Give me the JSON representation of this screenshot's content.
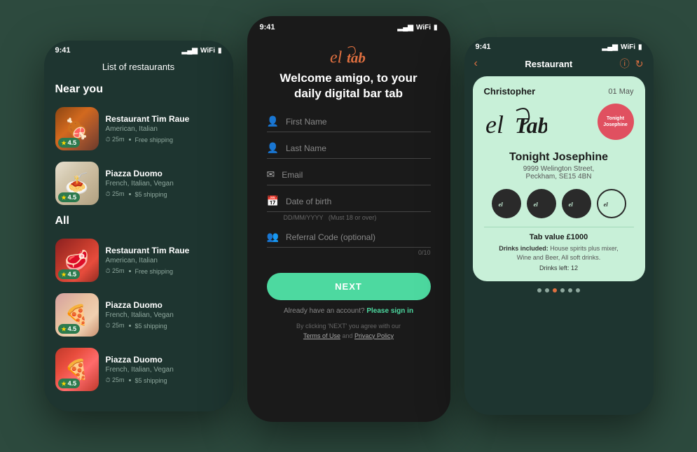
{
  "phone1": {
    "status_time": "9:41",
    "title": "List of restaurants",
    "section_near": "Near you",
    "section_all": "All",
    "restaurants_near": [
      {
        "name": "Restaurant Tim Raue",
        "cuisine": "American, Italian",
        "distance": "25m",
        "shipping": "Free shipping",
        "rating": "4.5",
        "thumb_class": "thumb-food1"
      },
      {
        "name": "Piazza Duomo",
        "cuisine": "French, Italian, Vegan",
        "distance": "25m",
        "shipping": "$5 shipping",
        "rating": "4.5",
        "thumb_class": "thumb-food2"
      }
    ],
    "restaurants_all": [
      {
        "name": "Restaurant Tim Raue",
        "cuisine": "American, Italian",
        "distance": "25m",
        "shipping": "Free shipping",
        "rating": "4.5",
        "thumb_class": "thumb-food3"
      },
      {
        "name": "Piazza Duomo",
        "cuisine": "French, Italian, Vegan",
        "distance": "25m",
        "shipping": "$5 shipping",
        "rating": "4.5",
        "thumb_class": "thumb-food4"
      },
      {
        "name": "Piazza Duomo",
        "cuisine": "French, Italian, Vegan",
        "distance": "25m",
        "shipping": "$5 shipping",
        "rating": "4.5",
        "thumb_class": "thumb-food5"
      }
    ]
  },
  "phone2": {
    "status_time": "9:41",
    "logo_text": "el tab",
    "welcome": "Welcome amigo, to your daily digital bar tab",
    "fields": [
      {
        "placeholder": "First Name",
        "icon": "👤",
        "type": "text"
      },
      {
        "placeholder": "Last Name",
        "icon": "👤",
        "type": "text"
      },
      {
        "placeholder": "Email",
        "icon": "✉",
        "type": "email"
      },
      {
        "placeholder": "Date of birth",
        "icon": "📅",
        "type": "text",
        "hint": "DD/MM/YYYY  (Must 18 or over)"
      },
      {
        "placeholder": "Referral Code (optional)",
        "icon": "👥",
        "type": "text",
        "count": "0/10"
      }
    ],
    "next_button": "NEXT",
    "signin_text": "Already have an account?",
    "signin_link": "Please sign in",
    "terms_pre": "By clicking 'NEXT' you agree with our",
    "terms_link1": "Terms of Use",
    "terms_and": " and ",
    "terms_link2": "Privacy Policy"
  },
  "phone3": {
    "status_time": "9:41",
    "nav_title": "Restaurant",
    "customer_name": "Christopher",
    "date": "01 May",
    "logo_text": "el Tab",
    "venue_badge_text": "Tonight\nJosephine",
    "venue_name": "Tonight Josephine",
    "venue_address": "9999 Welington Street,\nPeckham,  SE15 4BN",
    "tab_value": "Tab value £1000",
    "drinks_label": "Drinks included:",
    "drinks_desc": "House spirits plus mixer,\nWine and Beer, All soft drinks.",
    "drinks_left": "Drinks left:  12",
    "dots": [
      1,
      2,
      3,
      4,
      5,
      6
    ],
    "active_dot": 3
  }
}
